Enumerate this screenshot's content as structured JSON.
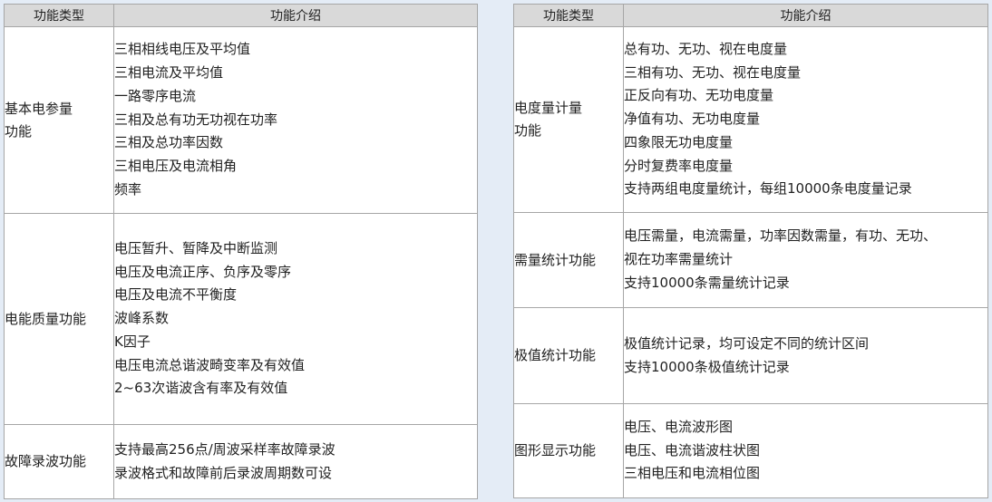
{
  "left_table": {
    "headers": [
      "功能类型",
      "功能介绍"
    ],
    "rows": [
      {
        "type": [
          "基本电参量",
          "功能"
        ],
        "items": [
          "三相相线电压及平均值",
          "三相电流及平均值",
          "一路零序电流",
          "三相及总有功无功视在功率",
          "三相及总功率因数",
          "三相电压及电流相角",
          "频率"
        ]
      },
      {
        "type": [
          "电能质量功能"
        ],
        "items": [
          "电压暂升、暂降及中断监测",
          "电压及电流正序、负序及零序",
          "电压及电流不平衡度",
          "波峰系数",
          "K因子",
          "电压电流总谐波畸变率及有效值",
          "2~63次谐波含有率及有效值"
        ]
      },
      {
        "type": [
          "故障录波功能"
        ],
        "items": [
          "支持最高256点/周波采样率故障录波",
          "录波格式和故障前后录波周期数可设"
        ]
      }
    ]
  },
  "right_table": {
    "headers": [
      "功能类型",
      "功能介绍"
    ],
    "rows": [
      {
        "type": [
          "电度量计量",
          "功能"
        ],
        "items": [
          "总有功、无功、视在电度量",
          "三相有功、无功、视在电度量",
          "正反向有功、无功电度量",
          "净值有功、无功电度量",
          "四象限无功电度量",
          "分时复费率电度量",
          "支持两组电度量统计，每组10000条电度量记录"
        ]
      },
      {
        "type": [
          "需量统计功能"
        ],
        "items": [
          "电压需量，电流需量，功率因数需量，有功、无功、",
          "视在功率需量统计",
          "支持10000条需量统计记录"
        ]
      },
      {
        "type": [
          "极值统计功能"
        ],
        "items": [
          "极值统计记录，均可设定不同的统计区间",
          "支持10000条极值统计记录"
        ]
      },
      {
        "type": [
          "图形显示功能"
        ],
        "items": [
          "电压、电流波形图",
          "电压、电流谐波柱状图",
          "三相电压和电流相位图"
        ]
      }
    ]
  }
}
